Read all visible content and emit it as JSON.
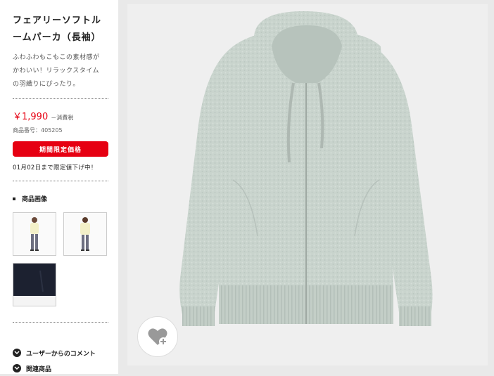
{
  "product": {
    "title_line1": "フェアリーソフトル",
    "title_line2": "ームパーカ（長袖）",
    "desc_line1": "ふわふわもこもこの素材感が",
    "desc_line2": "かわいい！リラックスタイム",
    "desc_line3": "の羽織りにぴったり。",
    "price": "￥1,990",
    "tax_label": "－消費税",
    "code_label": "商品番号：405205",
    "sale_badge": "期間限定価格",
    "sale_notice": "01月02日まで限定値下げ中！"
  },
  "images_section": {
    "heading": "商品画像"
  },
  "accordion": [
    {
      "label": "ユーザーからのコメント"
    },
    {
      "label": "関連商品"
    }
  ],
  "colors": {
    "accent_red": "#e60012",
    "hoodie": "#c9d4cd",
    "navy": "#1c2130"
  },
  "icons": {
    "favorite": "heart-plus-icon",
    "accordion": "chevron-down-icon"
  }
}
